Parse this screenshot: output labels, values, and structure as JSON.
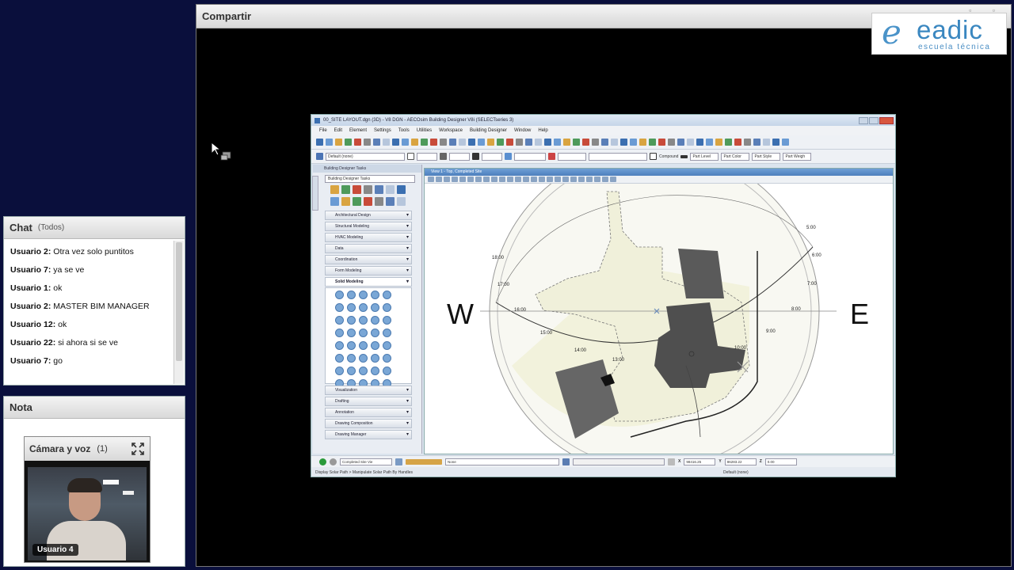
{
  "chat": {
    "title": "Chat",
    "scope": "(Todos)",
    "messages": [
      {
        "user": "Usuario 2:",
        "text": "Otra vez solo puntitos"
      },
      {
        "user": "Usuario 7:",
        "text": "ya se ve"
      },
      {
        "user": "Usuario 1:",
        "text": "ok"
      },
      {
        "user": "Usuario 2:",
        "text": "MASTER BIM MANAGER"
      },
      {
        "user": "Usuario 12:",
        "text": "ok"
      },
      {
        "user": "Usuario 22:",
        "text": "si ahora si se ve"
      },
      {
        "user": "Usuario 7:",
        "text": "go"
      }
    ]
  },
  "nota": {
    "title": "Nota"
  },
  "camera": {
    "title": "Cámara y voz",
    "count": "(1)",
    "speaker": "Usuario 4",
    "expand_icon": "expand-icon"
  },
  "share": {
    "title": "Compartir"
  },
  "logo": {
    "mark": "e",
    "name": "eadic",
    "tagline": "escuela técnica"
  },
  "app": {
    "title": "00_SITE LAYOUT.dgn (3D) - V8 DGN - AECOsim Building Designer V8i (SELECTseries 3)",
    "menu": [
      "File",
      "Edit",
      "Element",
      "Settings",
      "Tools",
      "Utilities",
      "Workspace",
      "Building Designer",
      "Window",
      "Help"
    ],
    "level_combo": "Default (none)",
    "compound_label": "Compound",
    "attribute_combos": [
      "Part Level",
      "Part Color",
      "Part Style",
      "Part Weigh"
    ],
    "tasks": {
      "header": "Building Designer Tasks",
      "combo": "Building Designer Tasks",
      "side_tab": "Project Explorer",
      "sections_top": [
        "Architectural Design",
        "Structural Modeling",
        "HVAC Modeling",
        "Data",
        "Coordination",
        "Form Modeling"
      ],
      "open_section": "Solid Modeling",
      "sections_bottom": [
        "Visualization",
        "Drafting",
        "Annotation",
        "Drawing Composition",
        "Drawing Manager"
      ]
    },
    "view": {
      "title": "View 1 - Top, Completed Site",
      "west": "W",
      "east": "E",
      "hours": [
        "5:00",
        "6:00",
        "7:00",
        "8:00",
        "9:00",
        "10:00",
        "13:00",
        "14:00",
        "15:00",
        "16:00",
        "17:00",
        "18:00"
      ]
    },
    "status": {
      "model_combo": "Completed Site Vie",
      "level_combo": "None",
      "x_label": "X",
      "x_value": "98416.25",
      "y_label": "Y",
      "y_value": "86283.22",
      "z_label": "Z",
      "z_value": "0.00"
    },
    "prompt": {
      "left": "Display Solar Path > Manipulate Solar Path By Handles",
      "right": "Default (none)"
    }
  },
  "colors": {
    "background": "#0a0f3c",
    "logo_blue": "#3a87c0",
    "building_dark": "#555555",
    "site_fill": "#f2f2dc"
  }
}
